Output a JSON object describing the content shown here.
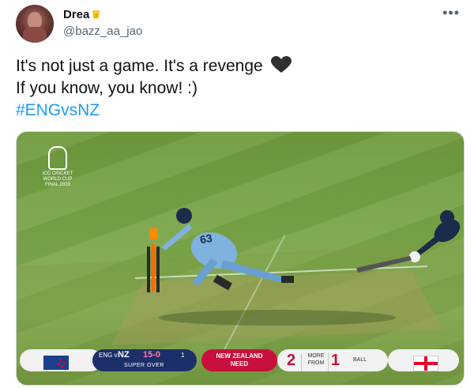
{
  "user": {
    "display_name": "Drea",
    "handle": "@bazz_aa_jao"
  },
  "tweet": {
    "line1": "It's not just a game. It's a revenge",
    "line2": "If you know, you know! :)",
    "hashtag": "#ENGvsNZ"
  },
  "media": {
    "logo_text": [
      "ICC CRICKET",
      "WORLD CUP",
      "FINAL 2019"
    ],
    "player_number": "63",
    "scoreboard": {
      "team_line": "ENG v",
      "team": "NZ",
      "score": "15-0",
      "balls_count": "1",
      "over_label": "SUPER OVER",
      "need_line1": "NEW ZEALAND",
      "need_line2": "NEED",
      "runs": "2",
      "more_from": "MORE FROM",
      "balls": "1",
      "ball_label": "BALL"
    }
  },
  "colors": {
    "hashtag": "#1d9bf0",
    "secondary": "#536471",
    "need": "#c7103b",
    "team_bar": "#1c2f6b"
  },
  "icons": [
    "more-options-icon",
    "heart-icon",
    "crown-emoji-icon",
    "nz-flag-icon",
    "england-flag-icon",
    "trophy-icon"
  ]
}
